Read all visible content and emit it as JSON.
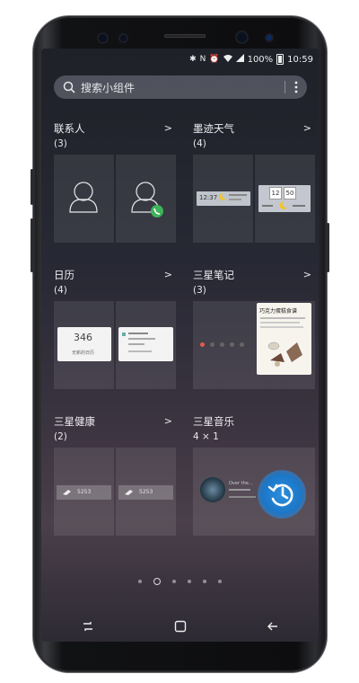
{
  "status": {
    "battery": "100%",
    "time": "10:59"
  },
  "search": {
    "placeholder": "搜索小组件"
  },
  "groups": {
    "contacts": {
      "title": "联系人",
      "count": "(3)"
    },
    "weather": {
      "title": "墨迹天气",
      "count": "(4)",
      "clock1": "12:37",
      "clock2a": "12",
      "clock2b": "50"
    },
    "calendar": {
      "title": "日历",
      "count": "(4)",
      "day": "346",
      "caption": "无新的日历"
    },
    "notes": {
      "title": "三星笔记",
      "count": "(3)",
      "card_title": "巧克力蛋糕食谱"
    },
    "health": {
      "title": "三星健康",
      "count": "(2)",
      "steps1": "5253",
      "steps2": "5253"
    },
    "music": {
      "title": "三星音乐",
      "count": "4 × 1",
      "track": "Over the..."
    }
  },
  "pager": {
    "pages": 6,
    "active": 1
  },
  "colors": {
    "accent": "#2a8fdc",
    "call_green": "#3fb35a",
    "moon_yellow": "#f5c518"
  }
}
